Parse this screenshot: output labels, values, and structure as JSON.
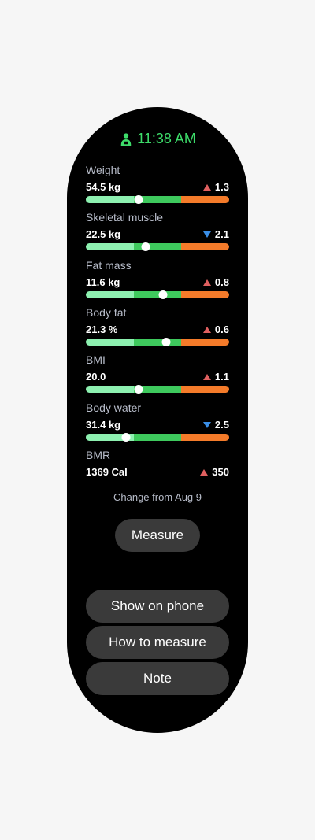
{
  "header": {
    "time": "11:38 AM",
    "icon": "person-scale-icon"
  },
  "metrics": [
    {
      "label": "Weight",
      "value": "54.5 kg",
      "change": "1.3",
      "direction": "up",
      "level": 0.37
    },
    {
      "label": "Skeletal muscle",
      "value": "22.5 kg",
      "change": "2.1",
      "direction": "down",
      "level": 0.42
    },
    {
      "label": "Fat mass",
      "value": "11.6 kg",
      "change": "0.8",
      "direction": "up",
      "level": 0.54
    },
    {
      "label": "Body fat",
      "value": "21.3 %",
      "change": "0.6",
      "direction": "up",
      "level": 0.56
    },
    {
      "label": "BMI",
      "value": "20.0",
      "change": "1.1",
      "direction": "up",
      "level": 0.37
    },
    {
      "label": "Body water",
      "value": "31.4 kg",
      "change": "2.5",
      "direction": "down",
      "level": 0.28
    },
    {
      "label": "BMR",
      "value": "1369 Cal",
      "change": "350",
      "direction": "up"
    }
  ],
  "caption": "Change from Aug 9",
  "buttons": {
    "measure": "Measure",
    "show_on_phone": "Show on phone",
    "how_to_measure": "How to measure",
    "note": "Note"
  },
  "colors": {
    "accent_green": "#3ddc6a",
    "bar_light": "#8df0b0",
    "bar_mid": "#3ec95d",
    "bar_high": "#f47b2a",
    "up": "#e06060",
    "down": "#3a8ee6"
  }
}
